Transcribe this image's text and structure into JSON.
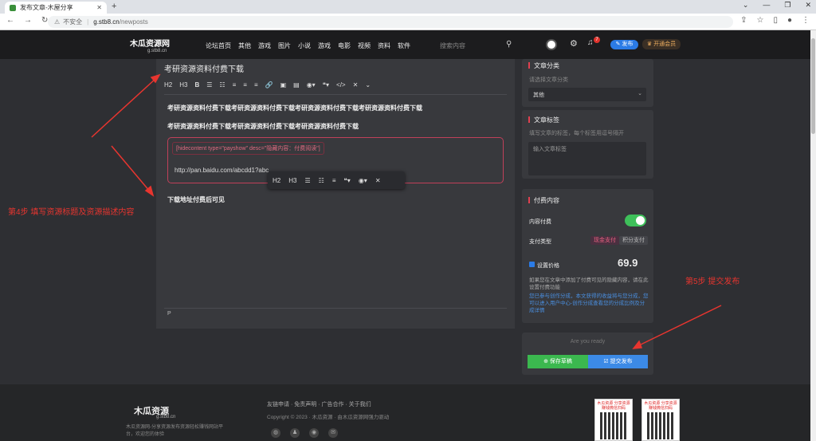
{
  "browser": {
    "tab_title": "发布文章-木屋分享",
    "omnibox_security": "不安全",
    "omnibox_host": "g.stb8.cn",
    "omnibox_path": "/newposts"
  },
  "header": {
    "logo_main": "木瓜资源网",
    "logo_sub": "g.stb8.cn",
    "nav": [
      "论坛首页",
      "其他",
      "游戏",
      "图片",
      "小说",
      "游戏",
      "电影",
      "视频",
      "资料",
      "软件"
    ],
    "search_placeholder": "搜索内容",
    "notification_count": "7",
    "publish_label": "发布",
    "vip_label": "开通会员"
  },
  "editor": {
    "title": "考研资源资料付费下载",
    "toolbar": [
      "H2",
      "H3",
      "B",
      "☰",
      "☷",
      "≡",
      "≡",
      "≡",
      "🔗",
      "▣",
      "▤",
      "◉▾",
      "❝▾",
      "</>",
      "✕",
      "⌄"
    ],
    "para1": "考研资源资料付费下载考研资源资料付费下载考研资源资料付费下载考研资源资料付费下载",
    "para2": "考研资源资料付费下载考研资源资料付费下载考研资源资料付费下载",
    "hidden_tag": "[hidecontent type=\"payshow\" desc=\"隐藏内容：付费阅读\"]",
    "hidden_link": "http://pan.baidu.com/abcdd1?abc",
    "float_toolbar": [
      "H2",
      "H3",
      "☰",
      "☷",
      "≡",
      "❝▾",
      "◉▾",
      "✕"
    ],
    "para3": "下载地址付费后可见",
    "status": "P"
  },
  "category": {
    "title": "文章分类",
    "hint": "请选择文章分类",
    "selected": "其他"
  },
  "tags": {
    "title": "文章标签",
    "hint": "填写文章的标签，每个标签用逗号隔开",
    "placeholder": "输入文章标签"
  },
  "paid": {
    "title": "付费内容",
    "content_paid_label": "内容付费",
    "pay_type_label": "支付类型",
    "pay_cash": "现金支付",
    "pay_points": "积分支付",
    "price_label": "设置价格",
    "price_value": "69.9",
    "desc1": "如果您在文章中添加了付费可见的隐藏内容，请在此设置付费功能",
    "desc2": "您已参与创作分成，本文获得的收益将与您分成，您可以进入用户中心-创作分成查看您的分成比例及分成详情"
  },
  "submit": {
    "ready": "Are you ready",
    "draft_label": "保存草稿",
    "submit_label": "提交发布"
  },
  "annotations": {
    "step4": "第4步 填写资源标题及资源描述内容",
    "step5": "第5步 提交发布"
  },
  "footer": {
    "logo": "木瓜资源",
    "logo_sub": "g.stb8.cn",
    "desc": "木瓜资源网-分享资源发布资源轻松赚钱网站平台，欢迎您的体验",
    "links": "友链申请 · 免责声明 · 广告合作 · 关于我们",
    "copyright": "Copyright © 2023 · 木瓜资源 · 由木瓜资源网强力驱动",
    "qr1_title": "木瓜资源 分享资源赚钱微信扫码",
    "qr2_title": "木瓜资源 分享资源赚钱微信扫码"
  }
}
